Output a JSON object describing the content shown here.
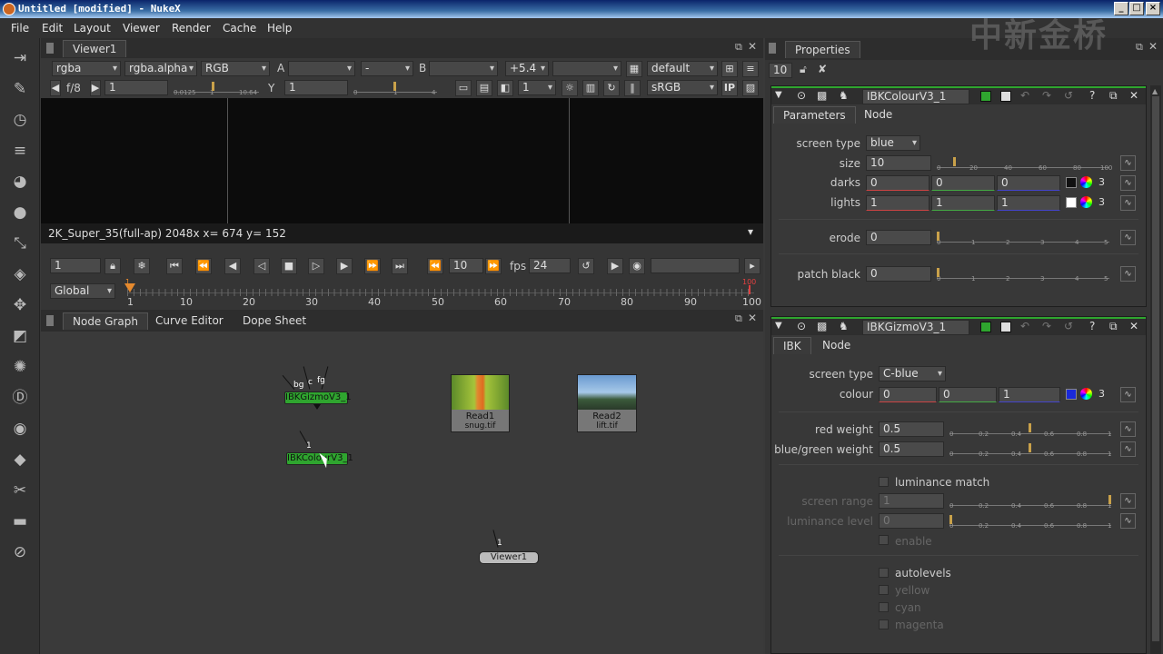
{
  "window": {
    "title": "Untitled [modified] - NukeX",
    "min": "_",
    "max": "□",
    "close": "×"
  },
  "menu": [
    "File",
    "Edit",
    "Layout",
    "Viewer",
    "Render",
    "Cache",
    "Help"
  ],
  "viewer": {
    "tab": "Viewer1",
    "row1": {
      "channels": "rgba",
      "alpha": "rgba.alpha",
      "rgb": "RGB",
      "a_label": "A",
      "a_value": "",
      "op": "-",
      "b_label": "B",
      "b_value": "",
      "zoom": "+5.4",
      ".mode": "2D",
      "view": "default"
    },
    "row2": {
      "fstop": "f/8",
      "gain": "1",
      "y_label": "Y",
      "gamma": "1",
      "proxy": "1",
      "lut": "sRGB",
      "ip": "IP",
      "gain_ticks": [
        "0.0125",
        "1",
        "10.64"
      ],
      "gamma_ticks": [
        "0",
        "1",
        "4"
      ]
    },
    "format_line": "2K_Super_35(full-ap) 2048x  x= 674 y= 152"
  },
  "timeline": {
    "frame": "1",
    "step": "10",
    "fps_label": "fps",
    "fps": "24",
    "range_mode": "Global",
    "ticks": [
      "1",
      "10",
      "20",
      "30",
      "40",
      "50",
      "60",
      "70",
      "80",
      "90",
      "100"
    ],
    "start": "1",
    "end": "100"
  },
  "graph": {
    "tabs": [
      "Node Graph",
      "Curve Editor",
      "Dope Sheet"
    ],
    "nodes": {
      "gizmo": {
        "label": "IBKGizmoV3_1",
        "inputs": [
          "bg",
          "c",
          "fg"
        ]
      },
      "colour": {
        "label": "IBKColourV3_1",
        "input": "1"
      },
      "read1": {
        "label": "Read1",
        "file": "snug.tif"
      },
      "read2": {
        "label": "Read2",
        "file": "lift.tif"
      },
      "viewer": {
        "label": "Viewer1",
        "input": "1"
      }
    }
  },
  "properties": {
    "title": "Properties",
    "max_panels": "10",
    "panel1": {
      "name": "IBKColourV3_1",
      "tabs": [
        "Parameters",
        "Node"
      ],
      "screen_type_label": "screen type",
      "screen_type": "blue",
      "size_label": "size",
      "size": "10",
      "size_ticks": [
        "0",
        "20",
        "40",
        "60",
        "80",
        "100"
      ],
      "darks_label": "darks",
      "darks": [
        "0",
        "0",
        "0"
      ],
      "darks_count": "3",
      "lights_label": "lights",
      "lights": [
        "1",
        "1",
        "1"
      ],
      "lights_count": "3",
      "erode_label": "erode",
      "erode": "0",
      "erode_ticks": [
        "0",
        "1",
        "2",
        "3",
        "4",
        "5"
      ],
      "patch_label": "patch black",
      "patch": "0"
    },
    "panel2": {
      "name": "IBKGizmoV3_1",
      "tabs": [
        "IBK",
        "Node"
      ],
      "screen_type_label": "screen type",
      "screen_type": "C-blue",
      "colour_label": "colour",
      "colour": [
        "0",
        "0",
        "1"
      ],
      "colour_count": "3",
      "red_label": "red weight",
      "red": "0.5",
      "bg_label": "blue/green weight",
      "bg": "0.5",
      "wticks": [
        "0",
        "0.2",
        "0.4",
        "0.6",
        "0.8",
        "1"
      ],
      "lum_match": "luminance match",
      "screen_range_label": "screen range",
      "screen_range": "1",
      "lum_level_label": "luminance level",
      "lum_level": "0",
      "enable": "enable",
      "autolevels": "autolevels",
      "yellow": "yellow",
      "cyan": "cyan",
      "magenta": "magenta"
    }
  },
  "watermark": "中新金桥",
  "colors": {
    "node_green": "#2fa52f",
    "accent": "#c9a14a"
  }
}
